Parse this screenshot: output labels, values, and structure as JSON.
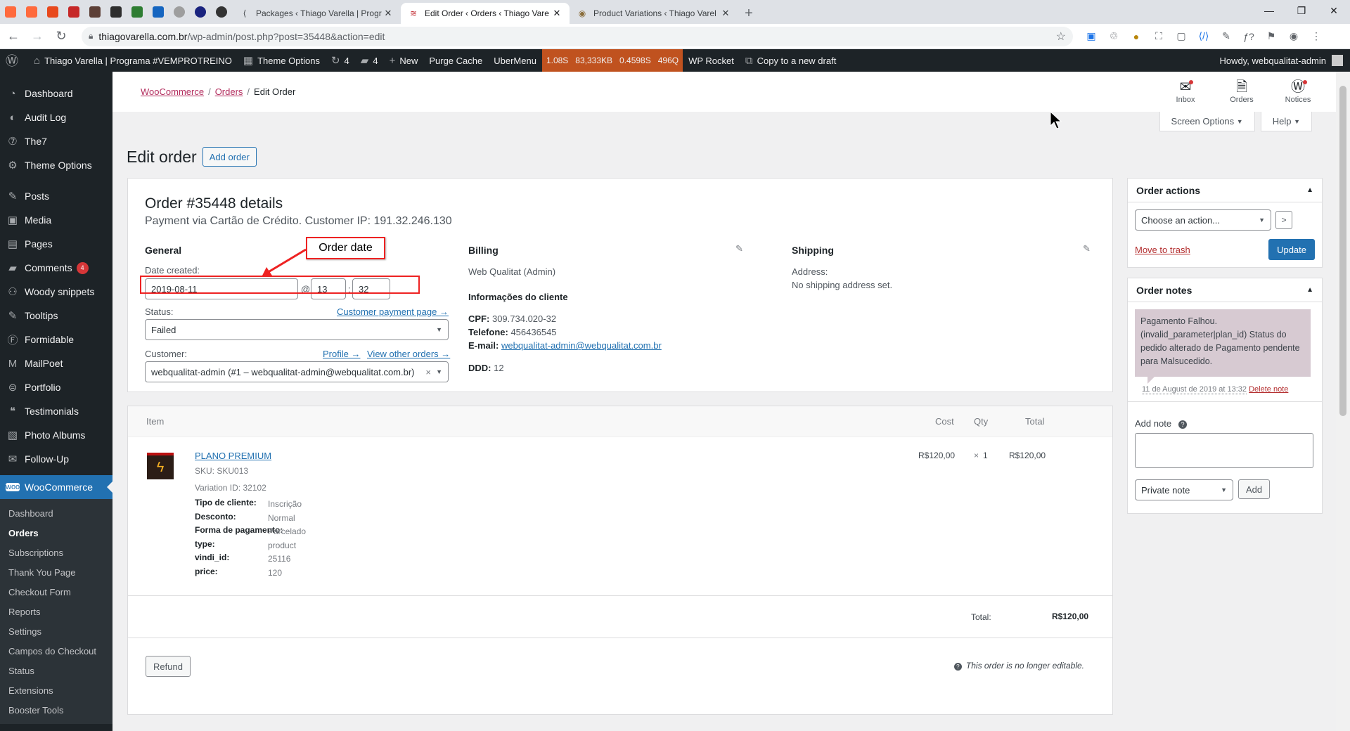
{
  "browser": {
    "extension_favicons": [
      "#ff6a3d",
      "#ff6a3d",
      "#e8491d",
      "#c62828",
      "#5d4037",
      "#2e2e2e",
      "#2e7d32",
      "#1565c0",
      "#9e9e9e",
      "#1a237e",
      "#333333"
    ],
    "tabs": [
      {
        "title": "Packages ‹ Thiago Varella | Progr",
        "icon": "share-icon",
        "active": false
      },
      {
        "title": "Edit Order ‹ Orders ‹ Thiago Vare",
        "icon": "woo-icon",
        "active": true
      },
      {
        "title": "Product Variations ‹ Thiago Varel",
        "icon": "wp-icon",
        "active": false
      }
    ],
    "url_host": "thiagovarella.com.br",
    "url_path": "/wp-admin/post.php?post=35448&action=edit"
  },
  "adminbar": {
    "site_name": "Thiago Varella | Programa #VEMPROTREINO",
    "theme_options": "Theme Options",
    "updates_count": "4",
    "comments_count": "4",
    "new_label": "New",
    "purge_cache": "Purge Cache",
    "ubermenu": "UberMenu",
    "qm": [
      "1.08S",
      "83,333KB",
      "0.4598S",
      "496Q"
    ],
    "wp_rocket": "WP Rocket",
    "copy_draft": "Copy to a new draft",
    "howdy": "Howdy, webqualitat-admin"
  },
  "sidebar": {
    "items": [
      {
        "label": "Dashboard",
        "icon": "dashboard-icon"
      },
      {
        "label": "Audit Log",
        "icon": "audit-icon"
      },
      {
        "label": "The7",
        "icon": "the7-icon"
      },
      {
        "label": "Theme Options",
        "icon": "gear-icon"
      },
      {
        "label": "Posts",
        "icon": "pin-icon"
      },
      {
        "label": "Media",
        "icon": "media-icon"
      },
      {
        "label": "Pages",
        "icon": "pages-icon"
      },
      {
        "label": "Comments",
        "icon": "comment-icon",
        "badge": "4"
      },
      {
        "label": "Woody snippets",
        "icon": "snippet-icon"
      },
      {
        "label": "Tooltips",
        "icon": "pin-icon"
      },
      {
        "label": "Formidable",
        "icon": "formidable-icon"
      },
      {
        "label": "MailPoet",
        "icon": "mailpoet-icon"
      },
      {
        "label": "Portfolio",
        "icon": "portfolio-icon"
      },
      {
        "label": "Testimonials",
        "icon": "testimonial-icon"
      },
      {
        "label": "Photo Albums",
        "icon": "album-icon"
      },
      {
        "label": "Follow-Up",
        "icon": "mail-icon"
      }
    ],
    "woocommerce": "WooCommerce",
    "sub_items": [
      "Dashboard",
      "Orders",
      "Subscriptions",
      "Thank You Page",
      "Checkout Form",
      "Reports",
      "Settings",
      "Campos do Checkout",
      "Status",
      "Extensions",
      "Booster Tools"
    ]
  },
  "header": {
    "breadcrumb": [
      "WooCommerce",
      "Orders",
      "Edit Order"
    ],
    "tools": [
      {
        "label": "Inbox",
        "icon": "inbox-icon"
      },
      {
        "label": "Orders",
        "icon": "orders-icon"
      },
      {
        "label": "Notices",
        "icon": "notices-icon"
      }
    ],
    "screen_options": "Screen Options",
    "help": "Help"
  },
  "page": {
    "title": "Edit order",
    "add_order": "Add order"
  },
  "order": {
    "title": "Order #35448 details",
    "subtitle": "Payment via Cartão de Crédito. Customer IP: 191.32.246.130",
    "general": {
      "heading": "General",
      "date_label": "Date created:",
      "date": "2019-08-11",
      "at": "@",
      "hour": "13",
      "colon": ":",
      "minute": "32",
      "status_label": "Status:",
      "payment_page_link": "Customer payment page →",
      "status": "Failed",
      "customer_label": "Customer:",
      "profile_link": "Profile →",
      "other_orders_link": "View other orders →",
      "customer": "webqualitat-admin (#1 – webqualitat-admin@webqualitat.com.br)",
      "clear": "×"
    },
    "billing": {
      "heading": "Billing",
      "name": "Web Qualitat (Admin)",
      "info_heading": "Informações do cliente",
      "cpf_label": "CPF:",
      "cpf": "309.734.020-32",
      "phone_label": "Telefone:",
      "phone": "456436545",
      "email_label": "E-mail:",
      "email": "webqualitat-admin@webqualitat.com.br",
      "ddd_label": "DDD:",
      "ddd": "12"
    },
    "shipping": {
      "heading": "Shipping",
      "address_label": "Address:",
      "address": "No shipping address set."
    }
  },
  "annotation": {
    "label": "Order date",
    "color": "#ee2222"
  },
  "items": {
    "headers": {
      "item": "Item",
      "cost": "Cost",
      "qty": "Qty",
      "total": "Total"
    },
    "product": {
      "name": "PLANO PREMIUM",
      "sku": "SKU: SKU013",
      "variation": "Variation ID: 32102",
      "meta": [
        {
          "key": "Tipo de cliente:",
          "value": "Inscrição"
        },
        {
          "key": "Desconto:",
          "value": "Normal"
        },
        {
          "key": "Forma de pagamento:",
          "value": "Parcelado"
        },
        {
          "key": "type:",
          "value": "product"
        },
        {
          "key": "vindi_id:",
          "value": "25116"
        },
        {
          "key": "price:",
          "value": "120"
        }
      ],
      "cost": "R$120,00",
      "qty_prefix": "×",
      "qty": "1",
      "total": "R$120,00"
    },
    "total_label": "Total:",
    "total": "R$120,00",
    "refund": "Refund",
    "not_editable": "This order is no longer editable."
  },
  "order_actions": {
    "heading": "Order actions",
    "select": "Choose an action...",
    "go": ">",
    "trash": "Move to trash",
    "update": "Update"
  },
  "order_notes": {
    "heading": "Order notes",
    "note": "Pagamento Falhou. (invalid_parameter|plan_id) Status do pedido alterado de Pagamento pendente para Malsucedido.",
    "note_date": "11 de August de 2019 at 13:32",
    "delete": "Delete note",
    "add_label": "Add note",
    "note_type": "Private note",
    "add_button": "Add"
  }
}
